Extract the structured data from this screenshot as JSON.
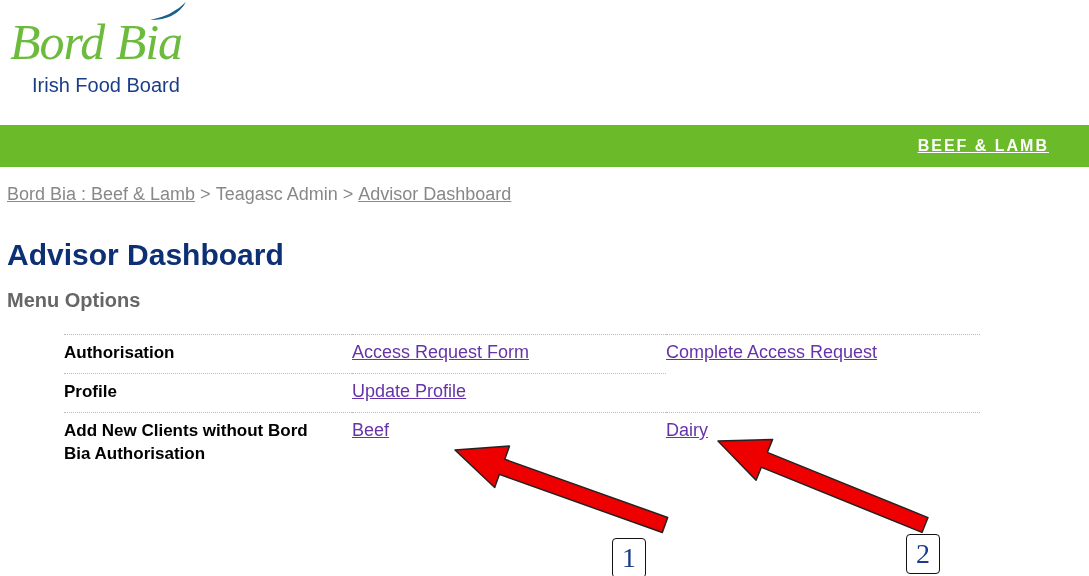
{
  "logo": {
    "name": "Bord Bia",
    "tagline": "Irish Food Board"
  },
  "banner": {
    "link": "BEEF & LAMB"
  },
  "breadcrumb": [
    {
      "label": "Bord Bia : Beef & Lamb",
      "link": true
    },
    {
      "label": ">",
      "link": false
    },
    {
      "label": "Teagasc Admin",
      "link": false
    },
    {
      "label": ">",
      "link": false
    },
    {
      "label": "Advisor Dashboard",
      "link": true
    }
  ],
  "title": "Advisor Dashboard",
  "subtitle": "Menu Options",
  "menu_rows": [
    {
      "label": "Authorisation",
      "links": [
        "Access Request Form",
        "Complete Access Request"
      ]
    },
    {
      "label": "Profile",
      "links": [
        "Update Profile"
      ]
    },
    {
      "label": "Add New Clients without Bord Bia Authorisation",
      "links": [
        "Beef",
        "Dairy"
      ]
    }
  ],
  "annotations": [
    {
      "label": "1"
    },
    {
      "label": "2"
    }
  ]
}
